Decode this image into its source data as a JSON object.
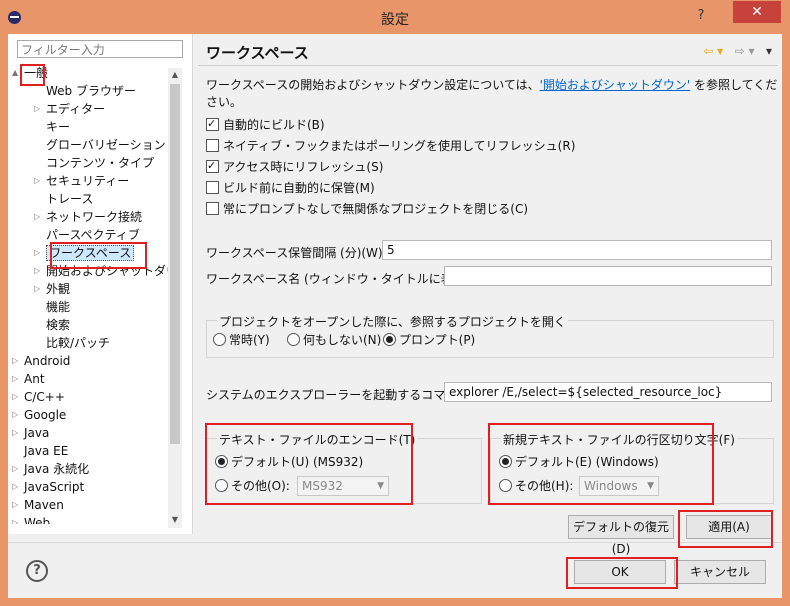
{
  "window": {
    "title": "設定",
    "help_label": "?",
    "close_label": "✕"
  },
  "filter": {
    "placeholder": "フィルター入力"
  },
  "tree": [
    {
      "label": "一般",
      "indent": 0,
      "twisty": "▲"
    },
    {
      "label": "Web ブラウザー",
      "indent": 1,
      "twisty": ""
    },
    {
      "label": "エディター",
      "indent": 1,
      "twisty": "▷"
    },
    {
      "label": "キー",
      "indent": 1,
      "twisty": ""
    },
    {
      "label": "グローバリゼーション",
      "indent": 1,
      "twisty": ""
    },
    {
      "label": "コンテンツ・タイプ",
      "indent": 1,
      "twisty": ""
    },
    {
      "label": "セキュリティー",
      "indent": 1,
      "twisty": "▷"
    },
    {
      "label": "トレース",
      "indent": 1,
      "twisty": ""
    },
    {
      "label": "ネットワーク接続",
      "indent": 1,
      "twisty": "▷"
    },
    {
      "label": "パースペクティブ",
      "indent": 1,
      "twisty": ""
    },
    {
      "label": "ワークスペース",
      "indent": 1,
      "twisty": "▷"
    },
    {
      "label": "開始およびシャットダウン",
      "indent": 1,
      "twisty": "▷"
    },
    {
      "label": "外観",
      "indent": 1,
      "twisty": "▷"
    },
    {
      "label": "機能",
      "indent": 1,
      "twisty": ""
    },
    {
      "label": "検索",
      "indent": 1,
      "twisty": ""
    },
    {
      "label": "比較/パッチ",
      "indent": 1,
      "twisty": ""
    },
    {
      "label": "Android",
      "indent": 0,
      "twisty": "▷"
    },
    {
      "label": "Ant",
      "indent": 0,
      "twisty": "▷"
    },
    {
      "label": "C/C++",
      "indent": 0,
      "twisty": "▷"
    },
    {
      "label": "Google",
      "indent": 0,
      "twisty": "▷"
    },
    {
      "label": "Java",
      "indent": 0,
      "twisty": "▷"
    },
    {
      "label": "Java EE",
      "indent": 0,
      "twisty": ""
    },
    {
      "label": "Java 永続化",
      "indent": 0,
      "twisty": "▷"
    },
    {
      "label": "JavaScript",
      "indent": 0,
      "twisty": "▷"
    },
    {
      "label": "Maven",
      "indent": 0,
      "twisty": "▷"
    },
    {
      "label": "Web",
      "indent": 0,
      "twisty": "▷"
    }
  ],
  "page": {
    "title": "ワークスペース",
    "nav_back": "⇦ ▾",
    "nav_forward": "⇨ ▾",
    "nav_menu": "▾",
    "desc_prefix": "ワークスペースの開始およびシャットダウン設定については、",
    "desc_link": "'開始およびシャットダウン'",
    "desc_suffix": " を参照してください。",
    "checkboxes": [
      {
        "label": "自動的にビルド(B)",
        "checked": true
      },
      {
        "label": "ネイティブ・フックまたはポーリングを使用してリフレッシュ(R)",
        "checked": false
      },
      {
        "label": "アクセス時にリフレッシュ(S)",
        "checked": true
      },
      {
        "label": "ビルド前に自動的に保管(M)",
        "checked": false
      },
      {
        "label": "常にプロンプトなしで無関係なプロジェクトを閉じる(C)",
        "checked": false
      }
    ],
    "save_interval_label": "ワークスペース保管間隔 (分)(W):",
    "save_interval_value": "5",
    "workspace_name_label": "ワークスペース名 (ウィンドウ・タイトルに表示)(K):",
    "workspace_name_value": "",
    "open_project_group": "プロジェクトをオープンした際に、参照するプロジェクトを開く",
    "open_project_options": [
      "常時(Y)",
      "何もしない(N)",
      "プロンプト(P)"
    ],
    "open_project_selected": 2,
    "explorer_label": "システムのエクスプローラーを起動するコマンド(X):",
    "explorer_value": "explorer /E,/select=${selected_resource_loc}",
    "encoding_group": "テキスト・ファイルのエンコード(T)",
    "encoding_default": "デフォルト(U) (MS932)",
    "encoding_other": "その他(O):",
    "encoding_combo": "MS932",
    "delimiter_group": "新規テキスト・ファイルの行区切り文字(F)",
    "delimiter_default": "デフォルト(E) (Windows)",
    "delimiter_other": "その他(H):",
    "delimiter_combo": "Windows",
    "restore_defaults": "デフォルトの復元(D)",
    "apply": "適用(A)"
  },
  "footer": {
    "help_icon": "?",
    "ok": "OK",
    "cancel": "キャンセル"
  },
  "colors": {
    "frame": "#e8956a",
    "close": "#c7423b",
    "highlight": "#e02020",
    "link": "#0066cc"
  }
}
